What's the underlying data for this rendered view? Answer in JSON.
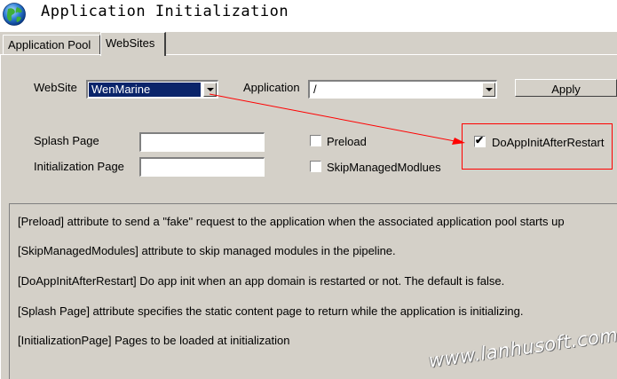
{
  "window": {
    "title": "Application Initialization",
    "icon": "globe-icon"
  },
  "tabs": [
    {
      "label": "Application Pool",
      "active": false
    },
    {
      "label": "WebSites",
      "active": true
    }
  ],
  "form": {
    "website_label": "WebSite",
    "website_value": "WenMarine",
    "application_label": "Application",
    "application_value": "/",
    "apply_label": "Apply",
    "splash_label": "Splash Page",
    "splash_value": "",
    "init_label": "Initialization Page",
    "init_value": "",
    "preload_label": "Preload",
    "preload_checked": false,
    "skip_label": "SkipManagedModlues",
    "skip_checked": false,
    "doapp_label": "DoAppInitAfterRestart",
    "doapp_checked": true
  },
  "info": {
    "lines": [
      "[Preload] attribute to send a \"fake\" request to the application when the associated application pool starts up",
      "[SkipManagedModules] attribute to skip managed modules in the pipeline.",
      "[DoAppInitAfterRestart] Do app init when an app domain is restarted or not. The default is false.",
      "[Splash Page] attribute specifies the static content page to return while the application is initializing.",
      "[InitializationPage] Pages to be loaded at initialization"
    ]
  },
  "watermark": "www.lanhusoft.com",
  "colors": {
    "selection": "#0a246a",
    "annotation": "#ff0000",
    "face": "#d4d0c8"
  }
}
